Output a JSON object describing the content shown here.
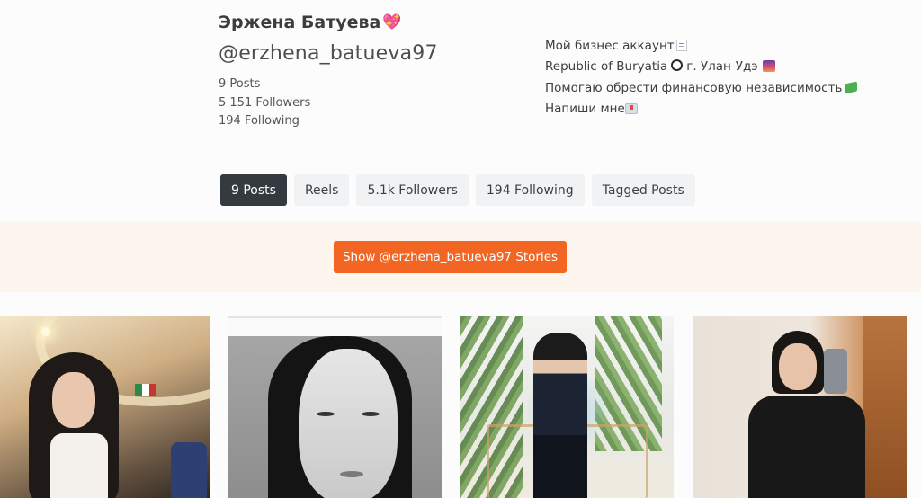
{
  "profile": {
    "name": "Эржена Батуева",
    "name_emoji": "💖",
    "handle": "@erzhena_batueva97",
    "stats": {
      "posts": "9 Posts",
      "followers": "5 151 Followers",
      "following": "194 Following"
    },
    "bio": {
      "line1": "Мой бизнес аккаунт",
      "line2_a": "Republic of Buryatia",
      "line2_b": "г. Улан-Удэ",
      "line3": "Помогаю обрести финансовую независимость",
      "line4": "Напиши мне"
    }
  },
  "tabs": [
    {
      "label": "9 Posts",
      "active": true
    },
    {
      "label": "Reels",
      "active": false
    },
    {
      "label": "5.1k Followers",
      "active": false
    },
    {
      "label": "194 Following",
      "active": false
    },
    {
      "label": "Tagged Posts",
      "active": false
    }
  ],
  "stories_button": "Show @erzhena_batueva97 Stories",
  "colors": {
    "accent": "#f26522",
    "active_tab": "#353a40",
    "tab_bg": "#f1f2f4",
    "band": "#fdf6ee"
  },
  "icons": {
    "heart": "sparkling-heart-emoji",
    "page": "page-facing-up-emoji",
    "ring": "hollow-circle-emoji",
    "night": "night-city-emoji",
    "money": "money-with-wings-emoji",
    "inbox": "inbox-tray-emoji"
  }
}
